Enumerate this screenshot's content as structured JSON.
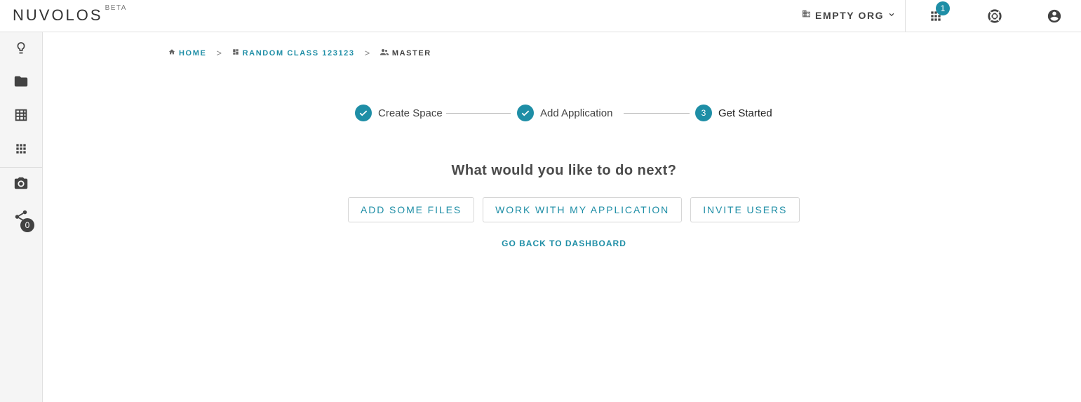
{
  "brand": {
    "name": "NUVOLOS",
    "tag": "BETA"
  },
  "topbar": {
    "org_name": "EMPTY ORG",
    "apps_badge": "1",
    "icons": [
      "building-icon",
      "chevron-down-icon",
      "apps-grid-icon",
      "lifebuoy-icon",
      "account-circle-icon"
    ]
  },
  "sidebar": {
    "items": [
      {
        "icon": "lightbulb-icon"
      },
      {
        "icon": "folder-icon"
      },
      {
        "icon": "table-icon"
      },
      {
        "icon": "apps-icon"
      },
      {
        "icon": "camera-icon"
      },
      {
        "icon": "share-icon",
        "badge": "0"
      }
    ]
  },
  "breadcrumb": {
    "home": "HOME",
    "space": "RANDOM CLASS 123123",
    "instance": "MASTER",
    "separator": ">"
  },
  "stepper": {
    "steps": [
      {
        "label": "Create Space",
        "state": "done"
      },
      {
        "label": "Add Application",
        "state": "done"
      },
      {
        "label": "Get Started",
        "state": "active",
        "number": "3"
      }
    ]
  },
  "main": {
    "question": "What would you like to do next?",
    "buttons": {
      "add_files": "ADD SOME FILES",
      "work_app": "WORK WITH MY APPLICATION",
      "invite_users": "INVITE USERS"
    },
    "back_link": "GO BACK TO DASHBOARD"
  },
  "colors": {
    "accent": "#1e8ea6",
    "text": "#424242",
    "sidebar_bg": "#f5f5f5"
  }
}
